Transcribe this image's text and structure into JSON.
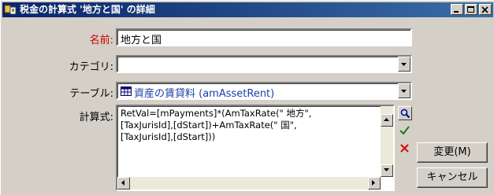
{
  "window": {
    "title": "税金の計算式 '地方と国' の詳細"
  },
  "form": {
    "name_label": "名前:",
    "name_value": "地方と国",
    "category_label": "カテゴリ:",
    "category_value": "",
    "table_label": "テーブル:",
    "table_value": "資産の賃貸料 (amAssetRent)",
    "formula_label": "計算式:",
    "formula_lines": [
      "RetVal=[mPayments]*(AmTaxRate(\" 地方\",",
      "[TaxJurisId],[dStart])+AmTaxRate(\" 国\",",
      "[TaxJurisId],[dStart]))"
    ]
  },
  "buttons": {
    "modify": "変更(M)",
    "cancel": "キャンセル"
  },
  "colors": {
    "name_label": "#cc0000",
    "titlebar_start": "#0a246a",
    "titlebar_end": "#3a6ea5"
  },
  "icons": {
    "title": "window-icon",
    "table": "table-icon",
    "zoom": "magnifier-icon",
    "validate": "checkmark-icon",
    "clear": "red-x-icon"
  }
}
